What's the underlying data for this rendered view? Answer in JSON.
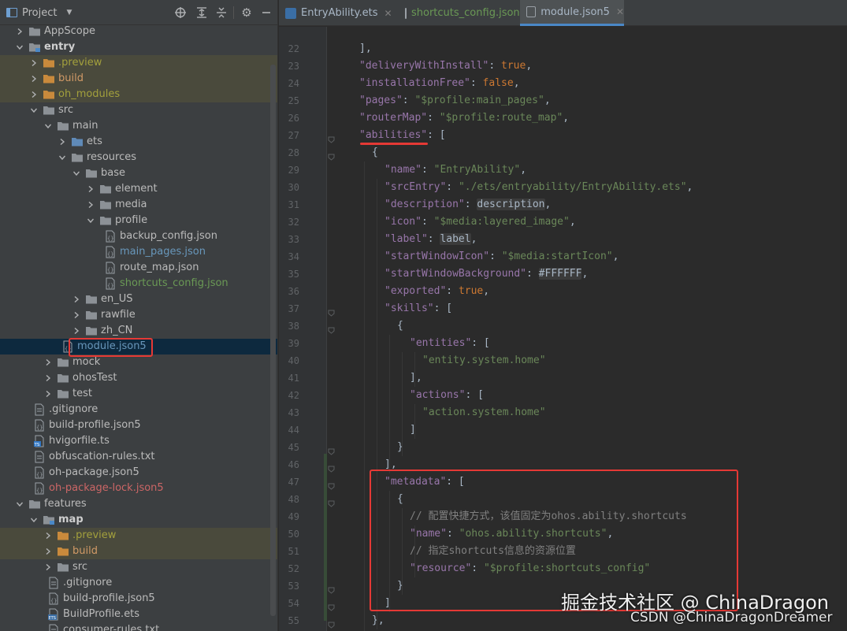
{
  "project_panel": {
    "title": "Project",
    "toolbar_icons": [
      "locate-icon",
      "expand-all-icon",
      "collapse-all-icon",
      "settings-icon",
      "hide-icon"
    ],
    "tree": [
      {
        "label": "AppScope",
        "depth": 0,
        "type": "folder",
        "expanded": false,
        "color": "default",
        "bold": false
      },
      {
        "label": "entry",
        "depth": 0,
        "type": "module",
        "expanded": true,
        "color": "default",
        "bold": true
      },
      {
        "label": ".preview",
        "depth": 1,
        "type": "folder-orange",
        "expanded": false,
        "color": "olive",
        "excluded": true
      },
      {
        "label": "build",
        "depth": 1,
        "type": "folder-orange",
        "expanded": false,
        "color": "orange",
        "excluded": true
      },
      {
        "label": "oh_modules",
        "depth": 1,
        "type": "folder-orange",
        "expanded": false,
        "color": "olive",
        "excluded": true
      },
      {
        "label": "src",
        "depth": 1,
        "type": "folder",
        "expanded": true,
        "color": "default"
      },
      {
        "label": "main",
        "depth": 2,
        "type": "folder",
        "expanded": true,
        "color": "default"
      },
      {
        "label": "ets",
        "depth": 3,
        "type": "folder-blue",
        "expanded": false,
        "color": "default"
      },
      {
        "label": "resources",
        "depth": 3,
        "type": "folder",
        "expanded": true,
        "color": "default"
      },
      {
        "label": "base",
        "depth": 4,
        "type": "folder",
        "expanded": true,
        "color": "default"
      },
      {
        "label": "element",
        "depth": 5,
        "type": "folder",
        "expanded": false,
        "color": "default"
      },
      {
        "label": "media",
        "depth": 5,
        "type": "folder",
        "expanded": false,
        "color": "default"
      },
      {
        "label": "profile",
        "depth": 5,
        "type": "folder",
        "expanded": true,
        "color": "default"
      },
      {
        "label": "backup_config.json",
        "depth": 6,
        "type": "json",
        "color": "default"
      },
      {
        "label": "main_pages.json",
        "depth": 6,
        "type": "json",
        "color": "blue"
      },
      {
        "label": "route_map.json",
        "depth": 6,
        "type": "json",
        "color": "default"
      },
      {
        "label": "shortcuts_config.json",
        "depth": 6,
        "type": "json",
        "color": "green"
      },
      {
        "label": "en_US",
        "depth": 4,
        "type": "folder",
        "expanded": false,
        "color": "default"
      },
      {
        "label": "rawfile",
        "depth": 4,
        "type": "folder",
        "expanded": false,
        "color": "default"
      },
      {
        "label": "zh_CN",
        "depth": 4,
        "type": "folder",
        "expanded": false,
        "color": "default"
      },
      {
        "label": "module.json5",
        "depth": 3,
        "type": "json",
        "color": "blue",
        "selected": true
      },
      {
        "label": "mock",
        "depth": 2,
        "type": "folder",
        "expanded": false,
        "color": "default"
      },
      {
        "label": "ohosTest",
        "depth": 2,
        "type": "folder",
        "expanded": false,
        "color": "default"
      },
      {
        "label": "test",
        "depth": 2,
        "type": "folder",
        "expanded": false,
        "color": "default"
      },
      {
        "label": ".gitignore",
        "depth": 1,
        "type": "file",
        "color": "default"
      },
      {
        "label": "build-profile.json5",
        "depth": 1,
        "type": "json",
        "color": "default"
      },
      {
        "label": "hvigorfile.ts",
        "depth": 1,
        "type": "ts",
        "color": "default"
      },
      {
        "label": "obfuscation-rules.txt",
        "depth": 1,
        "type": "text",
        "color": "default"
      },
      {
        "label": "oh-package.json5",
        "depth": 1,
        "type": "json",
        "color": "default"
      },
      {
        "label": "oh-package-lock.json5",
        "depth": 1,
        "type": "json",
        "color": "red"
      },
      {
        "label": "features",
        "depth": 0,
        "type": "folder",
        "expanded": true,
        "color": "default"
      },
      {
        "label": "map",
        "depth": 1,
        "type": "module",
        "expanded": true,
        "color": "default",
        "bold": true
      },
      {
        "label": ".preview",
        "depth": 2,
        "type": "folder-orange",
        "expanded": false,
        "color": "olive",
        "excluded": true
      },
      {
        "label": "build",
        "depth": 2,
        "type": "folder-orange",
        "expanded": false,
        "color": "orange",
        "excluded": true
      },
      {
        "label": "src",
        "depth": 2,
        "type": "folder",
        "expanded": false,
        "color": "default"
      },
      {
        "label": ".gitignore",
        "depth": 2,
        "type": "file",
        "color": "default"
      },
      {
        "label": "build-profile.json5",
        "depth": 2,
        "type": "json",
        "color": "default"
      },
      {
        "label": "BuildProfile.ets",
        "depth": 2,
        "type": "ets",
        "color": "default"
      },
      {
        "label": "consumer-rules.txt",
        "depth": 2,
        "type": "text",
        "color": "default"
      }
    ]
  },
  "editor": {
    "tabs": [
      {
        "label": "EntryAbility.ets",
        "icon": "ets-file-icon",
        "active": false,
        "color": "#a9b7c6"
      },
      {
        "label": "shortcuts_config.json",
        "icon": "json-file-icon",
        "active": false,
        "color": "#6a9955"
      },
      {
        "label": "module.json5",
        "icon": "json-file-icon",
        "active": true,
        "color": "#a9b7c6"
      }
    ],
    "close_glyph": "✕",
    "lines": [
      {
        "n": "22",
        "indent": 0,
        "tokens": [
          [
            "p",
            "],"
          ]
        ]
      },
      {
        "n": "23",
        "indent": 0,
        "tokens": [
          [
            "k",
            "\"deliveryWithInstall\""
          ],
          [
            "p",
            ": "
          ],
          [
            "kw",
            "true"
          ],
          [
            "p",
            ","
          ]
        ]
      },
      {
        "n": "24",
        "indent": 0,
        "tokens": [
          [
            "k",
            "\"installationFree\""
          ],
          [
            "p",
            ": "
          ],
          [
            "kw",
            "false"
          ],
          [
            "p",
            ","
          ]
        ]
      },
      {
        "n": "25",
        "indent": 0,
        "tokens": [
          [
            "k",
            "\"pages\""
          ],
          [
            "p",
            ": "
          ],
          [
            "s",
            "\"$profile:main_pages\""
          ],
          [
            "p",
            ","
          ]
        ]
      },
      {
        "n": "26",
        "indent": 0,
        "tokens": [
          [
            "k",
            "\"routerMap\""
          ],
          [
            "p",
            ": "
          ],
          [
            "s",
            "\"$profile:route_map\""
          ],
          [
            "p",
            ","
          ]
        ]
      },
      {
        "n": "27",
        "indent": 0,
        "tokens": [
          [
            "k",
            "\"abilities\""
          ],
          [
            "p",
            ": ["
          ]
        ]
      },
      {
        "n": "28",
        "indent": 1,
        "tokens": [
          [
            "p",
            "{"
          ]
        ]
      },
      {
        "n": "29",
        "indent": 2,
        "tokens": [
          [
            "k",
            "\"name\""
          ],
          [
            "p",
            ": "
          ],
          [
            "s",
            "\"EntryAbility\""
          ],
          [
            "p",
            ","
          ]
        ]
      },
      {
        "n": "30",
        "indent": 2,
        "tokens": [
          [
            "k",
            "\"srcEntry\""
          ],
          [
            "p",
            ": "
          ],
          [
            "s",
            "\"./ets/entryability/EntryAbility.ets\""
          ],
          [
            "p",
            ","
          ]
        ]
      },
      {
        "n": "31",
        "indent": 2,
        "tokens": [
          [
            "k",
            "\"description\""
          ],
          [
            "p",
            ": "
          ],
          [
            "hl",
            "description"
          ],
          [
            "p",
            ","
          ]
        ]
      },
      {
        "n": "32",
        "indent": 2,
        "tokens": [
          [
            "k",
            "\"icon\""
          ],
          [
            "p",
            ": "
          ],
          [
            "s",
            "\"$media:layered_image\""
          ],
          [
            "p",
            ","
          ]
        ]
      },
      {
        "n": "33",
        "indent": 2,
        "tokens": [
          [
            "k",
            "\"label\""
          ],
          [
            "p",
            ": "
          ],
          [
            "hl",
            "label"
          ],
          [
            "p",
            ","
          ]
        ]
      },
      {
        "n": "34",
        "indent": 2,
        "tokens": [
          [
            "k",
            "\"startWindowIcon\""
          ],
          [
            "p",
            ": "
          ],
          [
            "s",
            "\"$media:startIcon\""
          ],
          [
            "p",
            ","
          ]
        ]
      },
      {
        "n": "35",
        "indent": 2,
        "tokens": [
          [
            "k",
            "\"startWindowBackground\""
          ],
          [
            "p",
            ": "
          ],
          [
            "hl",
            "#FFFFFF"
          ],
          [
            "p",
            ","
          ]
        ]
      },
      {
        "n": "36",
        "indent": 2,
        "tokens": [
          [
            "k",
            "\"exported\""
          ],
          [
            "p",
            ": "
          ],
          [
            "kw",
            "true"
          ],
          [
            "p",
            ","
          ]
        ]
      },
      {
        "n": "37",
        "indent": 2,
        "tokens": [
          [
            "k",
            "\"skills\""
          ],
          [
            "p",
            ": ["
          ]
        ]
      },
      {
        "n": "38",
        "indent": 3,
        "tokens": [
          [
            "p",
            "{"
          ]
        ]
      },
      {
        "n": "39",
        "indent": 4,
        "tokens": [
          [
            "k",
            "\"entities\""
          ],
          [
            "p",
            ": ["
          ]
        ]
      },
      {
        "n": "40",
        "indent": 5,
        "tokens": [
          [
            "s",
            "\"entity.system.home\""
          ]
        ]
      },
      {
        "n": "41",
        "indent": 4,
        "tokens": [
          [
            "p",
            "],"
          ]
        ]
      },
      {
        "n": "42",
        "indent": 4,
        "tokens": [
          [
            "k",
            "\"actions\""
          ],
          [
            "p",
            ": ["
          ]
        ]
      },
      {
        "n": "43",
        "indent": 5,
        "tokens": [
          [
            "s",
            "\"action.system.home\""
          ]
        ]
      },
      {
        "n": "44",
        "indent": 4,
        "tokens": [
          [
            "p",
            "]"
          ]
        ]
      },
      {
        "n": "45",
        "indent": 3,
        "tokens": [
          [
            "p",
            "}"
          ]
        ]
      },
      {
        "n": "46",
        "indent": 2,
        "tokens": [
          [
            "p",
            "],"
          ]
        ]
      },
      {
        "n": "47",
        "indent": 2,
        "tokens": [
          [
            "k",
            "\"metadata\""
          ],
          [
            "p",
            ": ["
          ]
        ]
      },
      {
        "n": "48",
        "indent": 3,
        "tokens": [
          [
            "p",
            "{"
          ]
        ]
      },
      {
        "n": "49",
        "indent": 4,
        "tokens": [
          [
            "cm",
            "// 配置快捷方式，该值固定为ohos.ability.shortcuts"
          ]
        ]
      },
      {
        "n": "50",
        "indent": 4,
        "tokens": [
          [
            "k",
            "\"name\""
          ],
          [
            "p",
            ": "
          ],
          [
            "s",
            "\"ohos.ability.shortcuts\""
          ],
          [
            "p",
            ","
          ]
        ]
      },
      {
        "n": "51",
        "indent": 4,
        "tokens": [
          [
            "cm",
            "// 指定shortcuts信息的资源位置"
          ]
        ]
      },
      {
        "n": "52",
        "indent": 4,
        "tokens": [
          [
            "k",
            "\"resource\""
          ],
          [
            "p",
            ": "
          ],
          [
            "s",
            "\"$profile:shortcuts_config\""
          ]
        ]
      },
      {
        "n": "53",
        "indent": 3,
        "tokens": [
          [
            "p",
            "}"
          ]
        ]
      },
      {
        "n": "54",
        "indent": 2,
        "tokens": [
          [
            "p",
            "]"
          ]
        ]
      },
      {
        "n": "55",
        "indent": 1,
        "tokens": [
          [
            "p",
            "},"
          ]
        ]
      }
    ]
  },
  "watermark": {
    "line1": "掘金技术社区 @ ChinaDragon",
    "line2": "CSDN @ChinaDragonDreamer"
  },
  "colors": {
    "annotation_red": "#e53935",
    "selection": "#0d293e",
    "tab_underline": "#4a88c7"
  }
}
